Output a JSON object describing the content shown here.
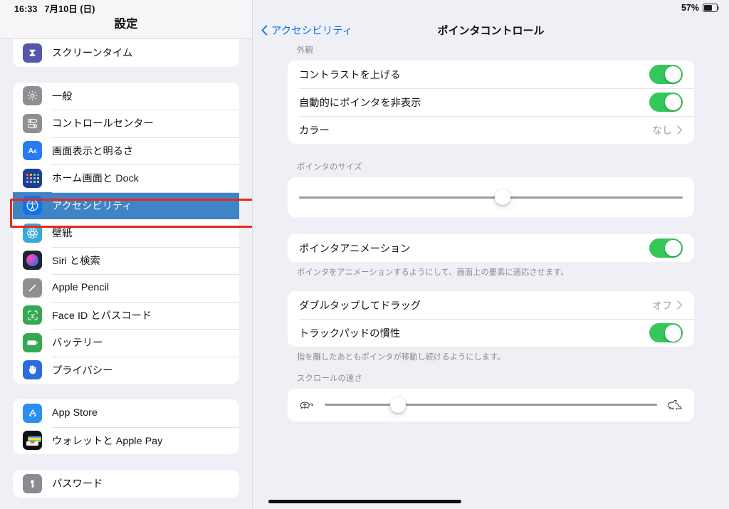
{
  "status_bar": {
    "time": "16:33",
    "date": "7月10日 (日)",
    "battery_percent": "57%",
    "battery_level": 57
  },
  "sidebar": {
    "title": "設定",
    "groups": [
      {
        "clipped": true,
        "items": [
          {
            "label": "スクリーンタイム",
            "icon": "hourglass-icon",
            "color": "#5556ac",
            "selected": false
          }
        ]
      },
      {
        "clipped": false,
        "items": [
          {
            "label": "一般",
            "icon": "gear-icon",
            "color": "#8e8e93",
            "selected": false
          },
          {
            "label": "コントロールセンター",
            "icon": "control-center-icon",
            "color": "#8e8e93",
            "selected": false
          },
          {
            "label": "画面表示と明るさ",
            "icon": "display-brightness-icon",
            "color": "#2a7bf0",
            "selected": false
          },
          {
            "label": "ホーム画面と Dock",
            "icon": "home-screen-icon",
            "color": "#1c3f94",
            "selected": false
          },
          {
            "label": "アクセシビリティ",
            "icon": "accessibility-icon",
            "color": "#1273e6",
            "selected": true
          },
          {
            "label": "壁紙",
            "icon": "wallpaper-icon",
            "color": "#3aa7dc",
            "selected": false
          },
          {
            "label": "Siri と検索",
            "icon": "siri-icon",
            "color": "#20242e",
            "selected": false
          },
          {
            "label": "Apple Pencil",
            "icon": "pencil-icon",
            "color": "#8e8e93",
            "selected": false
          },
          {
            "label": "Face ID とパスコード",
            "icon": "face-id-icon",
            "color": "#34a853",
            "selected": false
          },
          {
            "label": "バッテリー",
            "icon": "battery-icon",
            "color": "#34a853",
            "selected": false
          },
          {
            "label": "プライバシー",
            "icon": "privacy-hand-icon",
            "color": "#2a6ddb",
            "selected": false
          }
        ]
      },
      {
        "clipped": false,
        "items": [
          {
            "label": "App Store",
            "icon": "app-store-icon",
            "color": "#2a8ff0",
            "selected": false
          },
          {
            "label": "ウォレットと Apple Pay",
            "icon": "wallet-icon",
            "color": "#111114",
            "selected": false
          }
        ]
      },
      {
        "clipped": false,
        "items": [
          {
            "label": "パスワード",
            "icon": "key-icon",
            "color": "#8a8a90",
            "selected": false
          }
        ]
      }
    ],
    "selection_highlight_color": "#3f84c6",
    "annotation_color": "#e8291b"
  },
  "detail": {
    "back_label": "アクセシビリティ",
    "title": "ポインタコントロール",
    "appearance_section": {
      "header": "外観",
      "rows": [
        {
          "label": "コントラストを上げる",
          "control": "toggle",
          "state": "on"
        },
        {
          "label": "自動的にポインタを非表示",
          "control": "toggle",
          "state": "on"
        },
        {
          "label": "カラー",
          "control": "disclosure",
          "value": "なし"
        }
      ]
    },
    "pointer_size_section": {
      "header": "ポインタのサイズ",
      "slider_value": 53
    },
    "animation_section": {
      "row": {
        "label": "ポインタアニメーション",
        "control": "toggle",
        "state": "on"
      },
      "footer": "ポインタをアニメーションするようにして、画面上の要素に適応させます。"
    },
    "trackpad_section": {
      "rows": [
        {
          "label": "ダブルタップしてドラッグ",
          "control": "disclosure",
          "value": "オフ"
        },
        {
          "label": "トラックパッドの慣性",
          "control": "toggle",
          "state": "on"
        }
      ],
      "footer": "指を離したあともポインタが移動し続けるようにします。"
    },
    "scroll_speed_section": {
      "header": "スクロールの速さ",
      "slider_value": 22,
      "min_icon": "turtle-icon",
      "max_icon": "rabbit-icon"
    },
    "accent_color": "#0a73e8",
    "toggle_on_color": "#34c759"
  }
}
